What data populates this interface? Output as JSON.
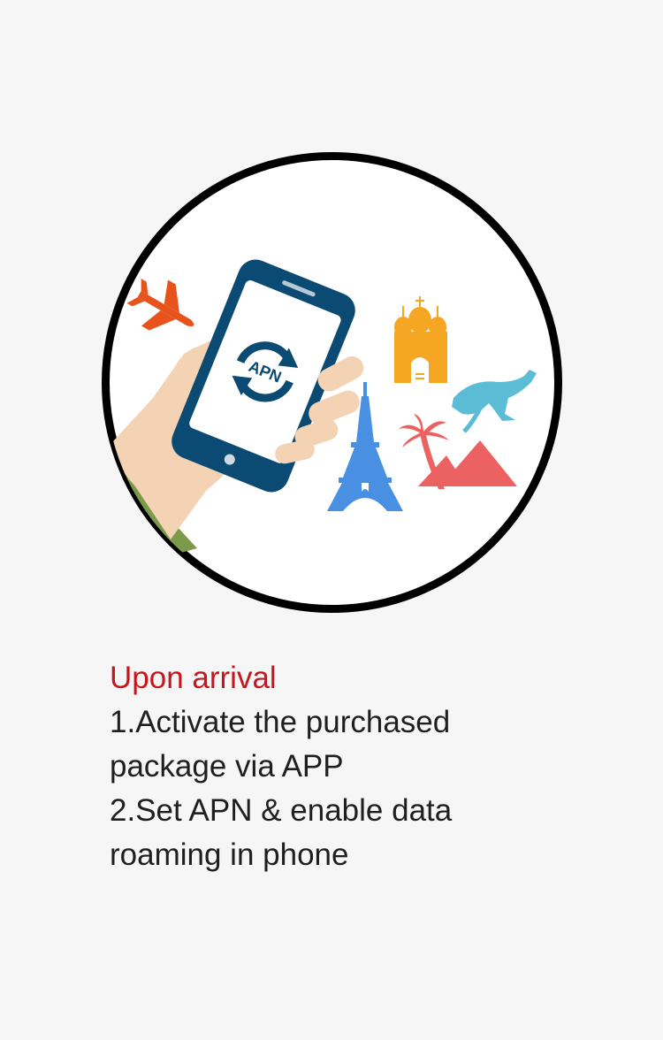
{
  "illustration": {
    "phone_screen_label": "APN",
    "colors": {
      "circle_outline": "#000000",
      "phone_body": "#0b4b73",
      "airplane": "#e8521b",
      "church": "#f5a623",
      "eiffel_tower": "#4a90e2",
      "kangaroo": "#5bbcd6",
      "pyramids": "#ec6161",
      "hand_skin": "#f4d2b4",
      "sleeve": "#7b9b4a"
    },
    "icons": [
      "airplane-icon",
      "church-icon",
      "kangaroo-icon",
      "eiffel-tower-icon",
      "palm-tree-icon",
      "pyramids-icon",
      "refresh-arrows-icon"
    ]
  },
  "caption": {
    "title": "Upon arrival",
    "lines": [
      "1.Activate the purchased",
      "package via APP",
      "2.Set APN & enable data",
      "roaming in phone"
    ]
  }
}
